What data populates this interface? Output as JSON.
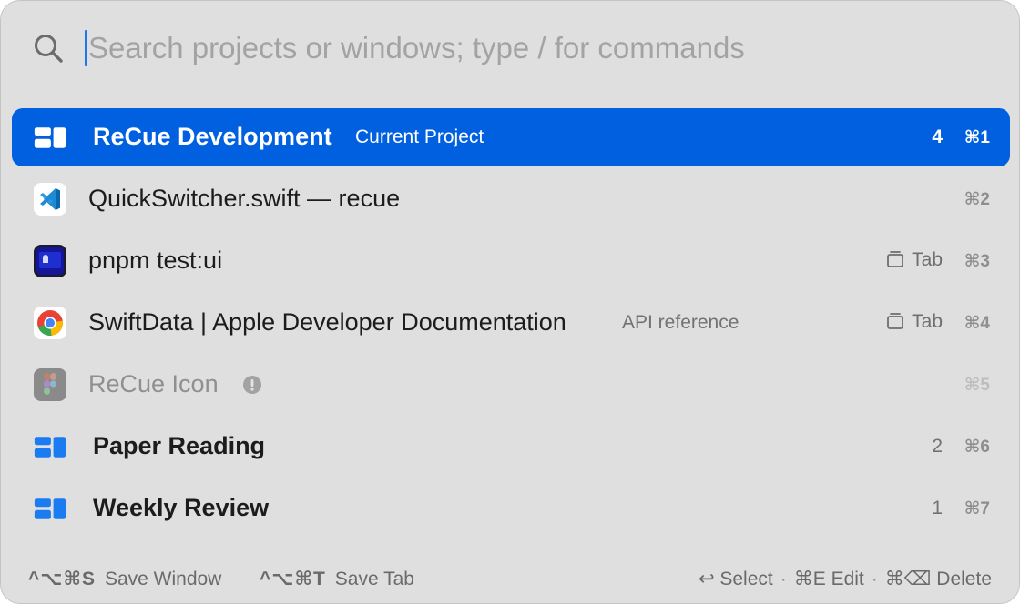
{
  "search": {
    "placeholder": "Search projects or windows; type / for commands",
    "value": ""
  },
  "items": [
    {
      "kind": "project",
      "icon": "project-icon",
      "title": "ReCue Development",
      "subtitle": "Current Project",
      "count": "4",
      "shortcut": "⌘1",
      "selected": true
    },
    {
      "kind": "window",
      "icon": "vscode-icon",
      "title": "QuickSwitcher.swift — recue",
      "shortcut": "⌘2"
    },
    {
      "kind": "window",
      "icon": "terminal-app-icon",
      "title": "pnpm test:ui",
      "tab_label": "Tab",
      "shortcut": "⌘3"
    },
    {
      "kind": "window",
      "icon": "chrome-icon",
      "title": "SwiftData | Apple Developer Documentation",
      "subtitle": "API reference",
      "tab_label": "Tab",
      "shortcut": "⌘4"
    },
    {
      "kind": "window",
      "icon": "figma-icon",
      "title": "ReCue Icon",
      "status_icon": "exclamation-icon",
      "shortcut": "⌘5",
      "disabled": true
    },
    {
      "kind": "project",
      "icon": "project-icon",
      "title": "Paper Reading",
      "count": "2",
      "shortcut": "⌘6"
    },
    {
      "kind": "project",
      "icon": "project-icon",
      "title": "Weekly Review",
      "count": "1",
      "shortcut": "⌘7"
    }
  ],
  "footer": {
    "save_window_keys": "^⌥⌘S",
    "save_window_label": "Save Window",
    "save_tab_keys": "^⌥⌘T",
    "save_tab_label": "Save Tab",
    "select_label": "↩ Select",
    "edit_label": "⌘E Edit",
    "delete_label": "⌘⌫ Delete",
    "separator": "·"
  },
  "colors": {
    "accent": "#0060df",
    "project_icon": "#1a7cf0",
    "panel_bg": "#dfdfdf"
  }
}
